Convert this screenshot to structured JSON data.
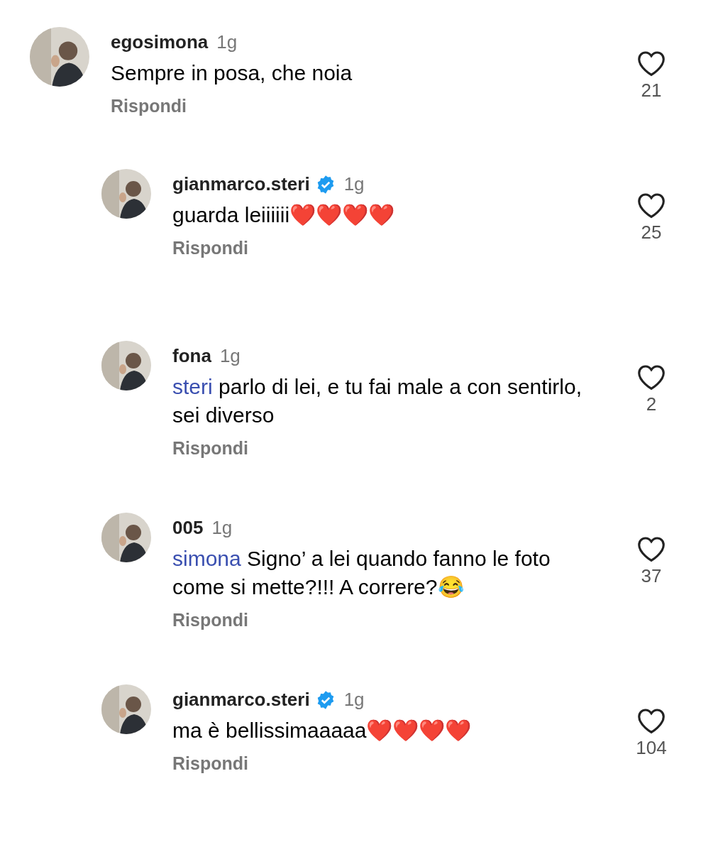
{
  "comments": [
    {
      "reply": false,
      "username": "egosimona",
      "verified": false,
      "time": "1g",
      "text": "Sempre in posa, che noia",
      "reply_label": "Rispondi",
      "likes": "21"
    },
    {
      "reply": true,
      "username": "gianmarco.steri",
      "verified": true,
      "time": "1g",
      "text": "guarda leiiiiii",
      "emoji": "❤️❤️❤️❤️",
      "reply_label": "Rispondi",
      "likes": "25"
    },
    {
      "reply": true,
      "username": "fona",
      "verified": false,
      "time": "1g",
      "mention": "steri",
      "text": "parlo di lei, e tu fai male a con sentirlo, sei diverso",
      "reply_label": "Rispondi",
      "likes": "2"
    },
    {
      "reply": true,
      "username": "005",
      "verified": false,
      "time": "1g",
      "mention": "simona",
      "text": "Signo’ a lei quando fanno le foto come si mette?!!! A correre?",
      "emoji": "😂",
      "reply_label": "Rispondi",
      "likes": "37"
    },
    {
      "reply": true,
      "username": "gianmarco.steri",
      "verified": true,
      "time": "1g",
      "text": "ma è bellissimaaaaa",
      "emoji": "❤️❤️❤️❤️",
      "reply_label": "Rispondi",
      "likes": "104"
    }
  ]
}
